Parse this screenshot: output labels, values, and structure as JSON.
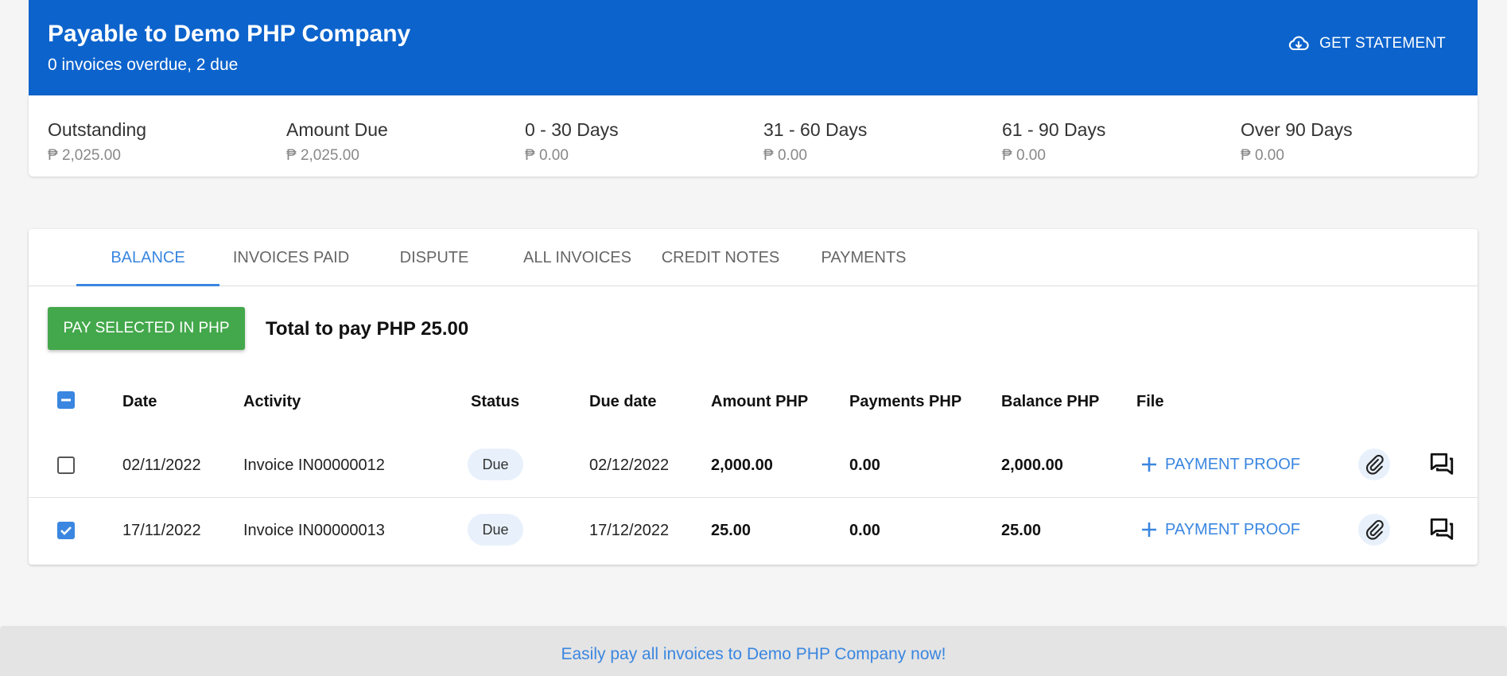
{
  "header": {
    "title": "Payable to Demo PHP Company",
    "subtitle": "0 invoices overdue, 2 due",
    "statement_label": "GET STATEMENT",
    "statement_icon": "cloud-download-icon",
    "bg_color": "#0c63cc"
  },
  "summary": [
    {
      "label": "Outstanding",
      "value": "₱ 2,025.00"
    },
    {
      "label": "Amount Due",
      "value": "₱ 2,025.00"
    },
    {
      "label": "0 - 30 Days",
      "value": "₱ 0.00"
    },
    {
      "label": "31 - 60 Days",
      "value": "₱ 0.00"
    },
    {
      "label": "61 - 90 Days",
      "value": "₱ 0.00"
    },
    {
      "label": "Over 90 Days",
      "value": "₱ 0.00"
    }
  ],
  "tabs": [
    {
      "label": "BALANCE",
      "active": true
    },
    {
      "label": "INVOICES PAID",
      "active": false
    },
    {
      "label": "DISPUTE",
      "active": false
    },
    {
      "label": "ALL INVOICES",
      "active": false
    },
    {
      "label": "CREDIT NOTES",
      "active": false
    },
    {
      "label": "PAYMENTS",
      "active": false
    }
  ],
  "actions": {
    "pay_button": "PAY SELECTED IN PHP",
    "total_text": "Total to pay PHP 25.00",
    "pay_color": "#43a84b"
  },
  "table": {
    "headers": {
      "date": "Date",
      "activity": "Activity",
      "status": "Status",
      "due_date": "Due date",
      "amount": "Amount PHP",
      "payments": "Payments PHP",
      "balance": "Balance PHP",
      "file": "File"
    },
    "rows": [
      {
        "checked": false,
        "date": "02/11/2022",
        "activity": "Invoice IN00000012",
        "status": "Due",
        "due_date": "02/12/2022",
        "amount": "2,000.00",
        "payments": "0.00",
        "balance": "2,000.00",
        "proof_label": "PAYMENT PROOF"
      },
      {
        "checked": true,
        "date": "17/11/2022",
        "activity": "Invoice IN00000013",
        "status": "Due",
        "due_date": "17/12/2022",
        "amount": "25.00",
        "payments": "0.00",
        "balance": "25.00",
        "proof_label": "PAYMENT PROOF"
      }
    ]
  },
  "footer": {
    "link_text": "Easily pay all invoices to Demo PHP Company now!"
  },
  "accent_color": "#3a86e0"
}
